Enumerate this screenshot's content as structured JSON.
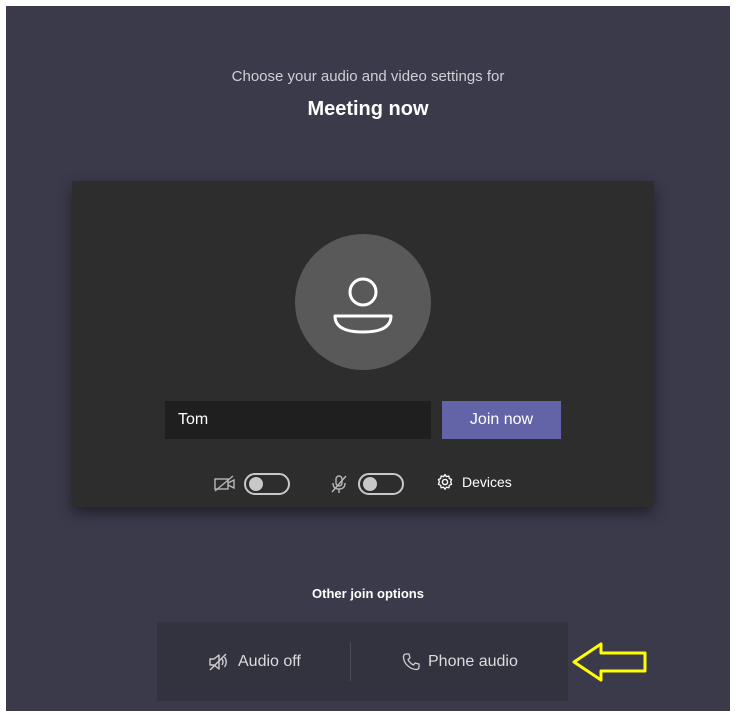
{
  "header": {
    "subtitle": "Choose your audio and video settings for",
    "meeting_title": "Meeting now"
  },
  "preview": {
    "avatar_icon": "person-icon",
    "name_value": "Tom",
    "join_label": "Join now",
    "camera": {
      "icon": "camera-off-icon",
      "on": false
    },
    "microphone": {
      "icon": "mic-off-icon",
      "on": false
    },
    "devices_label": "Devices",
    "devices_icon": "gear-icon"
  },
  "other_options": {
    "label": "Other join options",
    "audio_off_label": "Audio off",
    "audio_off_icon": "speaker-off-icon",
    "phone_audio_label": "Phone audio",
    "phone_audio_icon": "phone-icon"
  },
  "annotation": {
    "icon": "left-arrow-icon",
    "color": "#ffff00"
  },
  "colors": {
    "background": "#3a3a4b",
    "preview_panel": "#2d2d2d",
    "accent": "#6264a7"
  }
}
